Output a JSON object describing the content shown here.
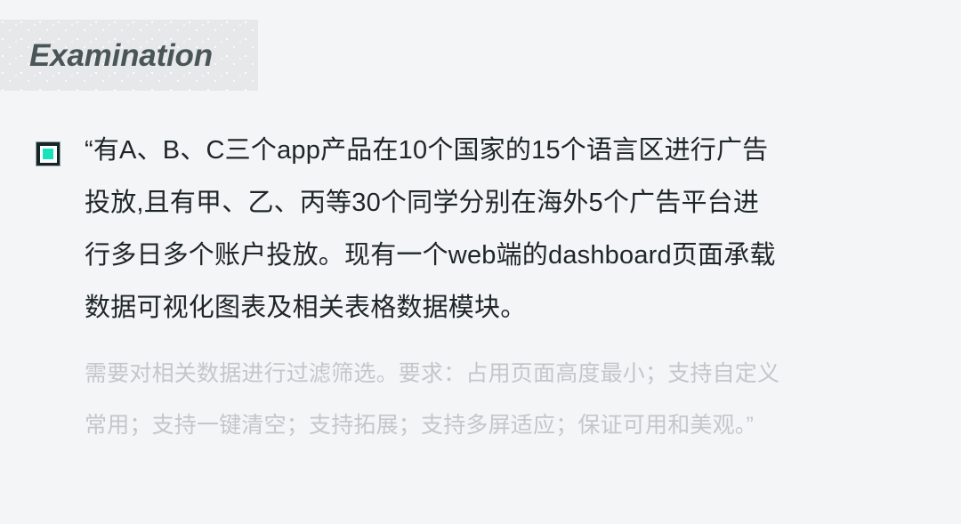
{
  "page": {
    "background_color": "#f4f5f7"
  },
  "header": {
    "title": "Examination",
    "band_color": "#e6e8ea",
    "title_color": "#4a5558"
  },
  "bullet": {
    "icon_name": "filled-square-marker-icon",
    "outer_color": "#13262a",
    "inner_frame_color": "#ffffff",
    "accent_color": "#19e3bb"
  },
  "statement": {
    "primary_color": "#1f2628",
    "secondary_color": "#c3c7ca",
    "primary_text": "“有A、B、C三个app产品在10个国家的15个语言区进行广告投放,且有甲、乙、丙等30个同学分别在海外5个广告平台进行多日多个账户投放。现有一个web端的dashboard页面承载数据可视化图表及相关表格数据模块。",
    "primary_lines": [
      "“有A、B、C三个app产品在10个国家的15个语言区进行广告",
      "投放,且有甲、乙、丙等30个同学分别在海外5个广告平台进",
      "行多日多个账户投放。现有一个web端的dashboard页面承载",
      "数据可视化图表及相关表格数据模块。"
    ],
    "secondary_text": "需要对相关数据进行过滤筛选。要求：占用页面高度最小；支持自定义常用；支持一键清空；支持拓展；支持多屏适应；保证可用和美观。”",
    "secondary_lines": [
      "需要对相关数据进行过滤筛选。要求：占用页面高度最小；支持自定义",
      "常用；支持一键清空；支持拓展；支持多屏适应；保证可用和美观。”"
    ]
  }
}
